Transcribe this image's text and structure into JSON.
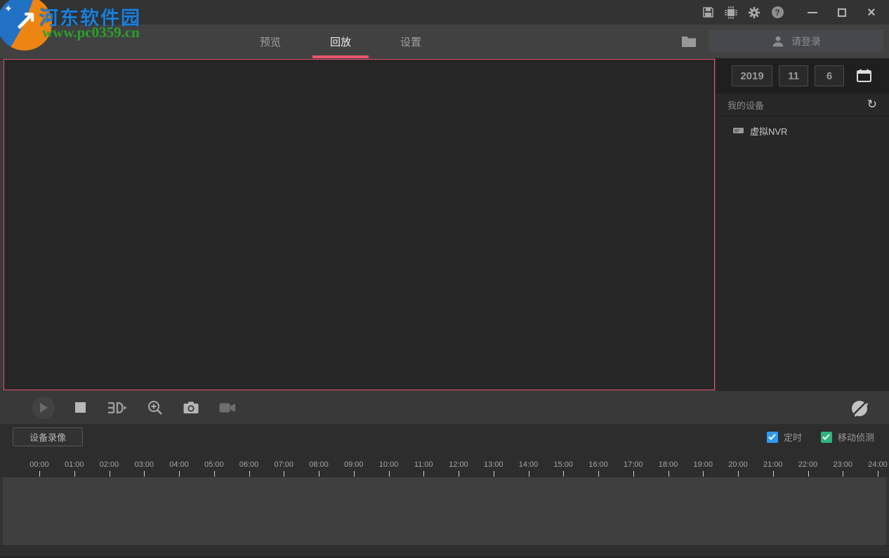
{
  "watermark": {
    "site_name": "河东软件园",
    "site_url": "www.pc0359.cn",
    "name_color": "#1d7ed6",
    "url_color": "#2aa12a",
    "arrow_glyph": "↗",
    "star_glyph": "✦"
  },
  "titlebar": {
    "icons": [
      "save-list-icon",
      "device-chip-icon",
      "settings-gear-icon",
      "help-icon"
    ],
    "help_glyph": "?",
    "close_glyph": "×"
  },
  "tabbar": {
    "tabs": [
      {
        "label": "预览",
        "active": false
      },
      {
        "label": "回放",
        "active": true
      },
      {
        "label": "设置",
        "active": false
      }
    ],
    "accent_color": "#e8566e",
    "login_label": "请登录"
  },
  "sidebar": {
    "date": {
      "year": "2019",
      "month": "11",
      "day": "6"
    },
    "group_label": "我的设备",
    "refresh_glyph": "↻",
    "devices": [
      {
        "label": "虚拟NVR"
      }
    ]
  },
  "player": {
    "controls": [
      "play",
      "stop",
      "frame-step",
      "zoom-in",
      "snapshot",
      "record"
    ],
    "audio_muted": true,
    "video_border_color": "#e8566e"
  },
  "bottom_bar": {
    "record_source_label": "设备录像",
    "checkboxes": [
      {
        "label": "定时",
        "checked": true,
        "color": "#2e9bf0"
      },
      {
        "label": "移动侦测",
        "checked": true,
        "color": "#2fb37c"
      }
    ]
  },
  "timeline": {
    "start": "00:00",
    "end": "24:00",
    "labels": [
      "00:00",
      "01:00",
      "02:00",
      "03:00",
      "04:00",
      "05:00",
      "06:00",
      "07:00",
      "08:00",
      "09:00",
      "10:00",
      "11:00",
      "12:00",
      "13:00",
      "14:00",
      "15:00",
      "16:00",
      "17:00",
      "18:00",
      "19:00",
      "20:00",
      "21:00",
      "22:00",
      "23:00",
      "24:00"
    ]
  }
}
